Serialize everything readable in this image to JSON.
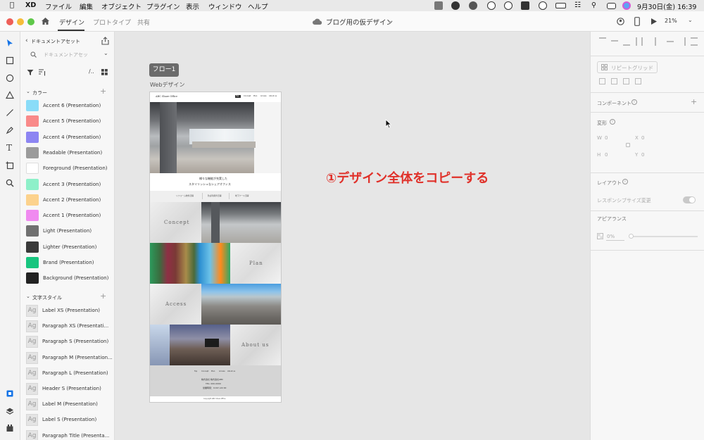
{
  "menubar": {
    "app": "XD",
    "menus": [
      "ファイル",
      "編集",
      "オブジェクト",
      "プラグイン",
      "表示",
      "ウィンドウ",
      "ヘルプ"
    ],
    "clock": "9月30日(金) 16:39"
  },
  "titlebar": {
    "tabs": [
      "デザイン",
      "プロトタイプ",
      "共有"
    ],
    "doc_title": "ブログ用の仮デザイン",
    "zoom": "21%"
  },
  "assets": {
    "title": "ドキュメントアセット",
    "search_placeholder": "ドキュメントアセッ",
    "colors_header": "カラー",
    "colors": [
      {
        "label": "Accent 6 (Presentation)",
        "color": "#8adcf8"
      },
      {
        "label": "Accent 5 (Presentation)",
        "color": "#f98a8a"
      },
      {
        "label": "Accent 4 (Presentation)",
        "color": "#8d85f2"
      },
      {
        "label": "Readable (Presentation)",
        "color": "#9b9b9b"
      },
      {
        "label": "Foreground (Presentation)",
        "color": "#ffffff"
      },
      {
        "label": "Accent 3 (Presentation)",
        "color": "#8ef0c9"
      },
      {
        "label": "Accent 2 (Presentation)",
        "color": "#fcd28d"
      },
      {
        "label": "Accent 1 (Presentation)",
        "color": "#f08af0"
      },
      {
        "label": "Light (Presentation)",
        "color": "#707070"
      },
      {
        "label": "Lighter (Presentation)",
        "color": "#3a3a3a"
      },
      {
        "label": "Brand (Presentation)",
        "color": "#18c57f"
      },
      {
        "label": "Background (Presentation)",
        "color": "#222222"
      }
    ],
    "char_header": "文字スタイル",
    "char_styles": [
      "Label XS (Presentation)",
      "Paragraph XS (Presentati...",
      "Paragraph S (Presentation)",
      "Paragraph M (Presentation...",
      "Paragraph L (Presentation)",
      "Header S (Presentation)",
      "Label M (Presentation)",
      "Label S (Presentation)",
      "Paragraph Title (Presenta..."
    ],
    "ag_glyph": "Ag"
  },
  "canvas": {
    "flow_label": "フロー1",
    "artboard_name": "Webデザイン",
    "annotation": "①デザイン全体をコピーする"
  },
  "artboard": {
    "logo": "ABC Share Office",
    "nav": [
      "Top",
      "Concept",
      "Plan",
      "Access",
      "About us"
    ],
    "hero_line1": "様々な機能が充実した",
    "hero_line2": "スタイリッシュなシェアオフィス",
    "features": [
      "リフォーム物件活躍",
      "防虚利用件活躍",
      "地下ケース活躍"
    ],
    "concept": "Concept",
    "plan": "Plan",
    "access": "Access",
    "about": "About us",
    "footer_nav": [
      "Top",
      "Concept",
      "Plan",
      "Access",
      "About us"
    ],
    "footer_company": "株式会社 株式会社ABC",
    "footer_tel": "TEL: 000-0000",
    "footer_hours": "営業時間：9:00～22:00",
    "copyright": "Copyright ABC Share Office"
  },
  "props": {
    "repeat_grid": "リピートグリッド",
    "component": "コンポーネント",
    "transform": "変形",
    "w_label": "W",
    "w_value": "0",
    "x_label": "X",
    "x_value": "0",
    "h_label": "H",
    "h_value": "0",
    "y_label": "Y",
    "y_value": "0",
    "layout": "レイアウト",
    "responsive": "レスポンシブサイズ変更",
    "appearance": "アピアランス",
    "opacity": "0%"
  }
}
